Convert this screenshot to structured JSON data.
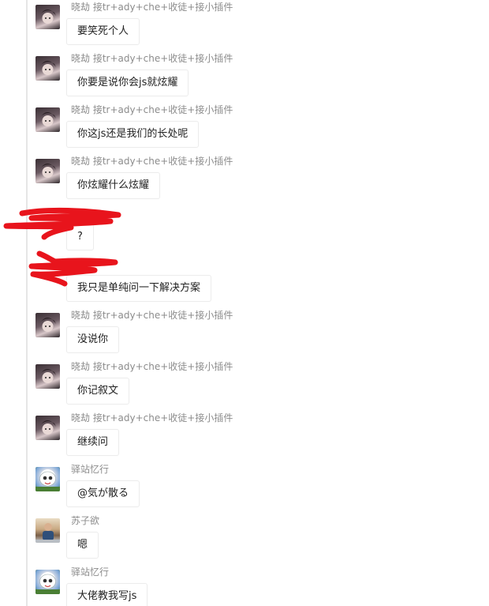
{
  "messages": [
    {
      "sender": "晓劫 接tr+ady+che+收徒+接小插件",
      "text": "要笑死个人",
      "avatar": "dark"
    },
    {
      "sender": "晓劫 接tr+ady+che+收徒+接小插件",
      "text": "你要是说你会js就炫耀",
      "avatar": "dark"
    },
    {
      "sender": "晓劫 接tr+ady+che+收徒+接小插件",
      "text": "你这js还是我们的长处呢",
      "avatar": "dark"
    },
    {
      "sender": "晓劫 接tr+ady+che+收徒+接小插件",
      "text": "你炫耀什么炫耀",
      "avatar": "dark"
    },
    {
      "sender": "",
      "text": "?",
      "avatar": "redacted"
    },
    {
      "sender": "",
      "text": "我只是单纯问一下解决方案",
      "avatar": "redacted"
    },
    {
      "sender": "晓劫 接tr+ady+che+收徒+接小插件",
      "text": "没说你",
      "avatar": "dark"
    },
    {
      "sender": "晓劫 接tr+ady+che+收徒+接小插件",
      "text": "你记叙文",
      "avatar": "dark"
    },
    {
      "sender": "晓劫 接tr+ady+che+收徒+接小插件",
      "text": "继续问",
      "avatar": "dark"
    },
    {
      "sender": "驿站忆行",
      "text": "@気が散る",
      "avatar": "cartoon"
    },
    {
      "sender": "苏子欲",
      "text": "嗯",
      "avatar": "photo"
    },
    {
      "sender": "驿站忆行",
      "text": "大佬教我写js",
      "avatar": "cartoon"
    }
  ],
  "colors": {
    "redaction": "#e8141c",
    "sender_text": "#8c8c8c",
    "bubble_border": "#ececec"
  }
}
